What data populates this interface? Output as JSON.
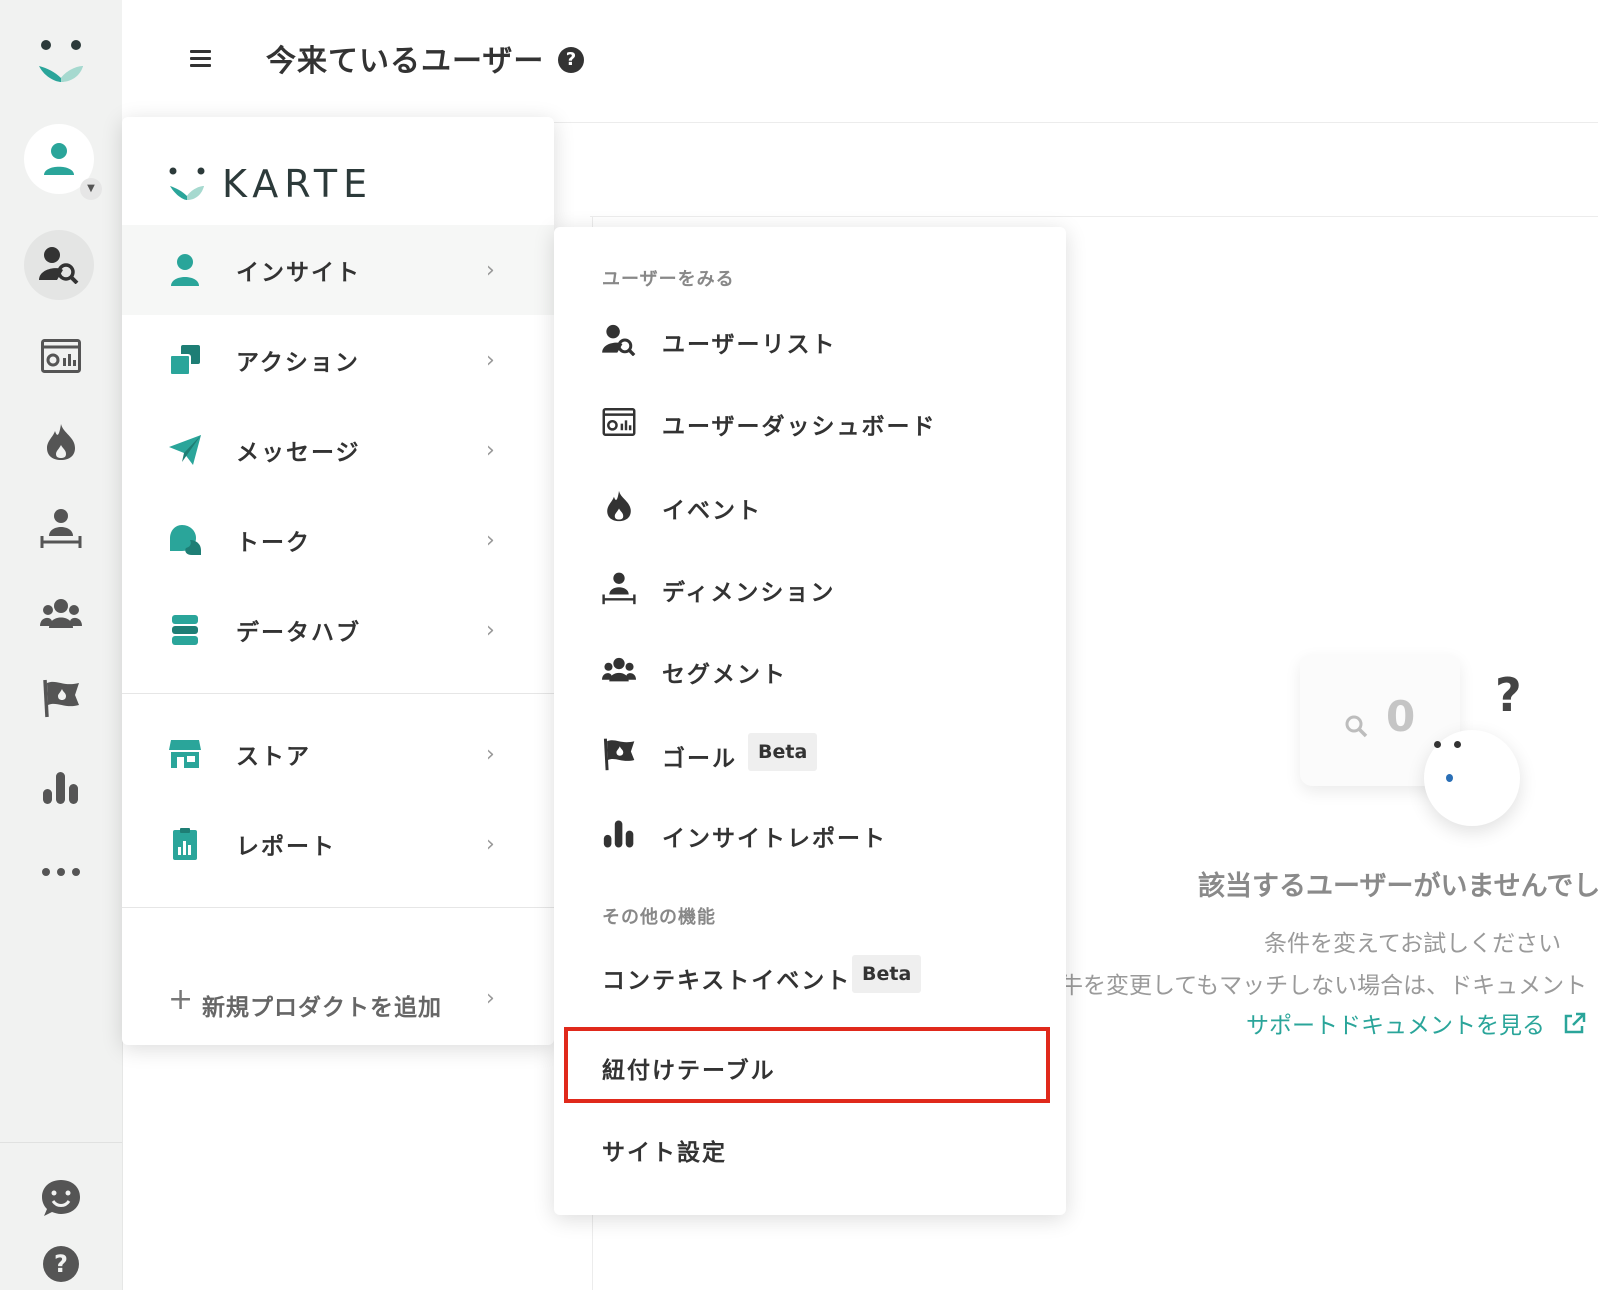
{
  "header": {
    "title": "今来ているユーザー",
    "help_glyph": "?"
  },
  "rail": {
    "icons": [
      "karte-logo-icon",
      "user-icon",
      "user-search-icon",
      "dashboard-icon",
      "fire-icon",
      "dimension-icon",
      "segment-icon",
      "goal-flag-icon",
      "bar-chart-icon",
      "more-icon",
      "chat-face-icon",
      "help-icon"
    ]
  },
  "main_menu": {
    "brand": "KARTE",
    "items": [
      {
        "label": "インサイト",
        "icon": "user-icon",
        "chevron": "›"
      },
      {
        "label": "アクション",
        "icon": "action-icon",
        "chevron": "›"
      },
      {
        "label": "メッセージ",
        "icon": "paper-plane-icon",
        "chevron": "›"
      },
      {
        "label": "トーク",
        "icon": "talk-bubble-icon",
        "chevron": "›"
      },
      {
        "label": "データハブ",
        "icon": "database-icon",
        "chevron": "›"
      },
      {
        "label": "ストア",
        "icon": "store-icon",
        "chevron": "›"
      },
      {
        "label": "レポート",
        "icon": "report-icon",
        "chevron": "›"
      }
    ],
    "add_product": {
      "plus": "+",
      "label": "新規プロダクトを追加",
      "chevron": "›"
    }
  },
  "submenu": {
    "section_users": "ユーザーをみる",
    "items": [
      {
        "label": "ユーザーリスト",
        "icon": "user-search-icon"
      },
      {
        "label": "ユーザーダッシュボード",
        "icon": "dashboard-icon"
      },
      {
        "label": "イベント",
        "icon": "fire-icon"
      },
      {
        "label": "ディメンション",
        "icon": "dimension-icon"
      },
      {
        "label": "セグメント",
        "icon": "segment-icon"
      },
      {
        "label": "ゴール",
        "icon": "goal-flag-icon",
        "badge": "Beta"
      },
      {
        "label": "インサイトレポート",
        "icon": "bar-chart-icon"
      }
    ],
    "section_other": "その他の機能",
    "other_items": [
      {
        "label": "コンテキストイベント",
        "badge": "Beta"
      },
      {
        "label": "紐付けテーブル"
      },
      {
        "label": "サイト設定"
      }
    ]
  },
  "empty_state": {
    "count": "0",
    "question": "?",
    "title": "該当するユーザーがいませんでし",
    "subtitle": "条件を変えてお試しください",
    "note": "牛を変更してもマッチしない場合は、ドキュメント",
    "link": "サポートドキュメントを見る"
  },
  "colors": {
    "brand_teal": "#2aa59a",
    "highlight_red": "#e0291b",
    "icon_dark": "#333333"
  }
}
